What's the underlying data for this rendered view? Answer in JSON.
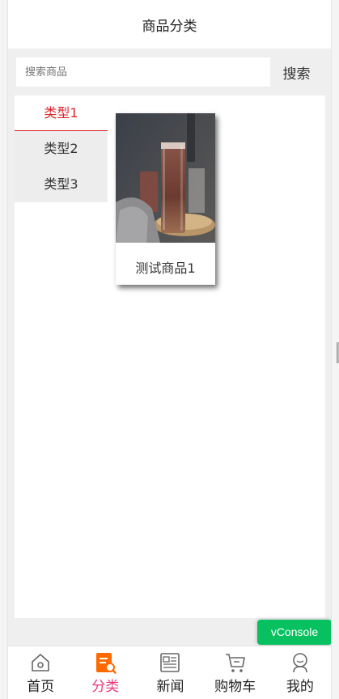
{
  "header": {
    "title": "商品分类"
  },
  "search": {
    "placeholder": "搜索商品",
    "value": "",
    "button_label": "搜索"
  },
  "categories": [
    {
      "label": "类型1",
      "active": true
    },
    {
      "label": "类型2",
      "active": false
    },
    {
      "label": "类型3",
      "active": false
    }
  ],
  "goods": [
    {
      "name": "测试商品1",
      "image": "iced-tea-glass-photo"
    }
  ],
  "tabbar": {
    "items": [
      {
        "label": "首页",
        "icon": "home-icon"
      },
      {
        "label": "分类",
        "icon": "category-icon",
        "active": true
      },
      {
        "label": "新闻",
        "icon": "news-icon"
      },
      {
        "label": "购物车",
        "icon": "cart-icon"
      },
      {
        "label": "我的",
        "icon": "profile-icon"
      }
    ]
  },
  "vconsole": {
    "label": "vConsole"
  },
  "colors": {
    "accent_red": "#e0242b",
    "tab_active": "#e8377d",
    "category_orange": "#ff6a00",
    "vconsole_green": "#07c160"
  }
}
